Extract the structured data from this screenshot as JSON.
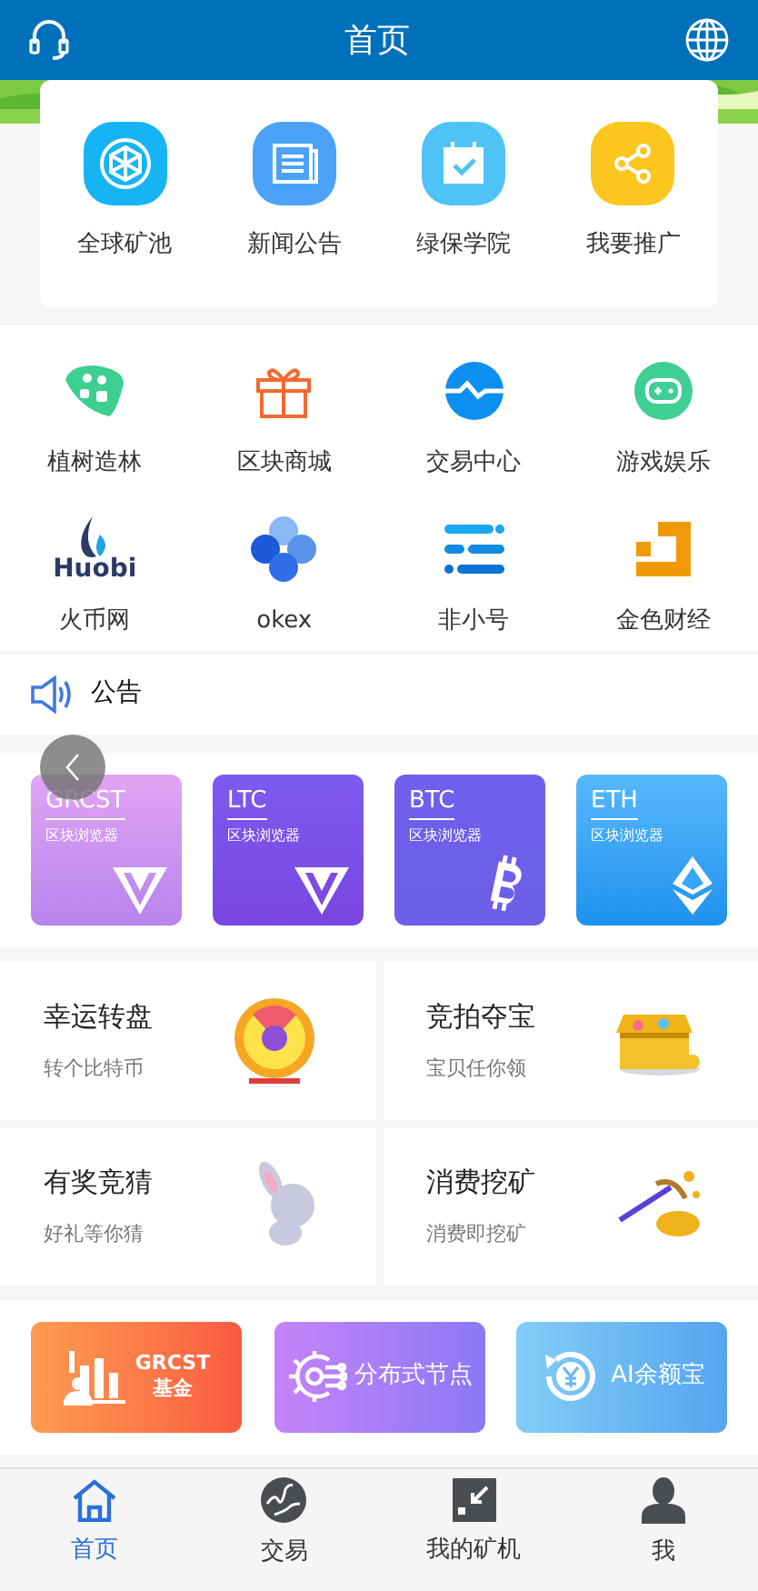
{
  "header": {
    "title": "首页"
  },
  "quick_links": [
    {
      "label": "全球矿池",
      "kind": "pool"
    },
    {
      "label": "新闻公告",
      "kind": "news"
    },
    {
      "label": "绿保学院",
      "kind": "calendar"
    },
    {
      "label": "我要推广",
      "kind": "share"
    }
  ],
  "apps": [
    {
      "label": "植树造林",
      "kind": "tree"
    },
    {
      "label": "区块商城",
      "kind": "gift"
    },
    {
      "label": "交易中心",
      "kind": "exchange"
    },
    {
      "label": "游戏娱乐",
      "kind": "game"
    },
    {
      "label": "火币网",
      "kind": "huobi",
      "logo_text": "Huobi"
    },
    {
      "label": "okex",
      "kind": "okex"
    },
    {
      "label": "非小号",
      "kind": "feixiaohao"
    },
    {
      "label": "金色财经",
      "kind": "jinse"
    }
  ],
  "notice": {
    "label": "公告"
  },
  "explorers": [
    {
      "symbol": "GRCST",
      "subtitle": "区块浏览器",
      "kind": "tron_pink"
    },
    {
      "symbol": "LTC",
      "subtitle": "区块浏览器",
      "kind": "tron_purple"
    },
    {
      "symbol": "BTC",
      "subtitle": "区块浏览器",
      "kind": "btc"
    },
    {
      "symbol": "ETH",
      "subtitle": "区块浏览器",
      "kind": "eth"
    }
  ],
  "features": [
    {
      "title": "幸运转盘",
      "subtitle": "转个比特币",
      "kind": "wheel"
    },
    {
      "title": "竞拍夺宝",
      "subtitle": "宝贝任你领",
      "kind": "chest"
    },
    {
      "title": "有奖竞猜",
      "subtitle": "好礼等你猜",
      "kind": "rabbit"
    },
    {
      "title": "消费挖矿",
      "subtitle": "消费即挖矿",
      "kind": "pickaxe"
    }
  ],
  "banners": [
    {
      "lines": [
        "GRCST",
        "基金"
      ],
      "kind": "fund"
    },
    {
      "lines": [
        "分布式节点"
      ],
      "kind": "node"
    },
    {
      "lines": [
        "AI余额宝"
      ],
      "kind": "yuebao"
    }
  ],
  "tabs": [
    {
      "label": "首页",
      "selected": true,
      "kind": "home"
    },
    {
      "label": "交易",
      "selected": false,
      "kind": "trade"
    },
    {
      "label": "我的矿机",
      "selected": false,
      "kind": "miner"
    },
    {
      "label": "我",
      "selected": false,
      "kind": "me"
    }
  ]
}
